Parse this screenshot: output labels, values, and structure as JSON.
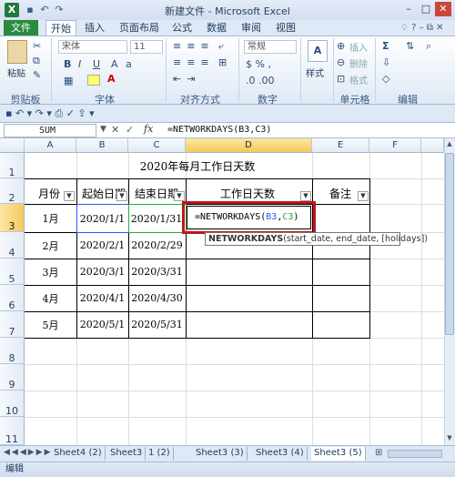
{
  "window": {
    "title": "新建文件 - Microsoft Excel",
    "app_icon": "X",
    "controls": [
      "–",
      "□",
      "✕"
    ]
  },
  "ribbon_tabs": [
    "文件",
    "开始",
    "插入",
    "页面布局",
    "公式",
    "数据",
    "审阅",
    "视图"
  ],
  "ribbon": {
    "font_name": "宋体",
    "font_size": "11",
    "number_format": "常规",
    "paste_label": "粘贴",
    "style_label": "样式",
    "insert_label": "插入",
    "delete_label": "删除",
    "format_label": "格式",
    "groups": [
      "剪贴板",
      "字体",
      "对齐方式",
      "数字",
      "单元格",
      "编辑"
    ]
  },
  "formula_bar": {
    "name_box": "SUM",
    "fx": "fx",
    "cancel": "✕",
    "enter": "✓",
    "formula": "=NETWORKDAYS(B3,C3)"
  },
  "columns": [
    "A",
    "B",
    "C",
    "D",
    "E",
    "F"
  ],
  "rows": [
    "1",
    "2",
    "3",
    "4",
    "5",
    "6",
    "7",
    "8",
    "9",
    "10",
    "11"
  ],
  "table": {
    "title": "2020年每月工作日天数",
    "headers": [
      "月份",
      "起始日期",
      "结束日期",
      "工作日天数",
      "备注"
    ],
    "data": [
      {
        "month": "1月",
        "start": "2020/1/1",
        "end": "2020/1/31"
      },
      {
        "month": "2月",
        "start": "2020/2/1",
        "end": "2020/2/29"
      },
      {
        "month": "3月",
        "start": "2020/3/1",
        "end": "2020/3/31"
      },
      {
        "month": "4月",
        "start": "2020/4/1",
        "end": "2020/4/30"
      },
      {
        "month": "5月",
        "start": "2020/5/1",
        "end": "2020/5/31"
      }
    ]
  },
  "editing_cell": {
    "prefix": "=NETWORKDAYS(",
    "arg1": "B3",
    "comma": ",",
    "arg2": "C3",
    "suffix": ")"
  },
  "tooltip": {
    "fn": "NETWORKDAYS",
    "args": "(start_date, end_date, [holidays])"
  },
  "sheet_tabs": [
    "Sheet4 (2)",
    "Sheet3",
    "1 (2)",
    "Sheet3 (3)",
    "Sheet3 (4)",
    "Sheet3 (5)"
  ],
  "active_sheet": "Sheet3 (5)",
  "status": "编辑",
  "colors": {
    "file_tab": "#2a8a3e",
    "highlight_box": "#c0141c",
    "ref_b3": "#3355ff",
    "ref_c3": "#22aa44"
  }
}
